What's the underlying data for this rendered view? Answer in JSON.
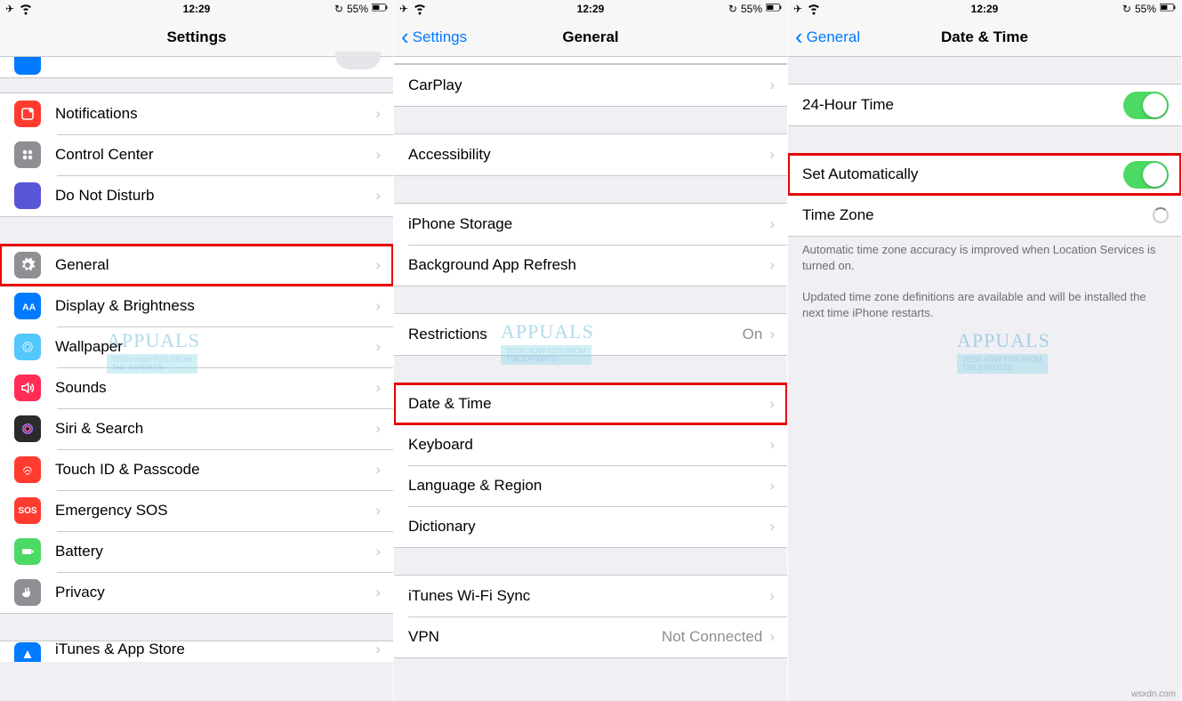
{
  "status": {
    "time": "12:29",
    "battery": "55%"
  },
  "watermark": {
    "name": "APPUALS",
    "tagline1": "TECH HOW-TO'S FROM",
    "tagline2": "THE EXPERTS!"
  },
  "attribution": "wsxdn.com",
  "screen1": {
    "title": "Settings",
    "items": {
      "notifications": "Notifications",
      "control_center": "Control Center",
      "dnd": "Do Not Disturb",
      "general": "General",
      "display": "Display & Brightness",
      "wallpaper": "Wallpaper",
      "sounds": "Sounds",
      "siri": "Siri & Search",
      "touch_id": "Touch ID & Passcode",
      "sos": "Emergency SOS",
      "battery": "Battery",
      "privacy": "Privacy",
      "itunes": "iTunes & App Store"
    }
  },
  "screen2": {
    "back": "Settings",
    "title": "General",
    "items": {
      "carplay": "CarPlay",
      "accessibility": "Accessibility",
      "iphone_storage": "iPhone Storage",
      "bg_refresh": "Background App Refresh",
      "restrictions": "Restrictions",
      "restrictions_value": "On",
      "date_time": "Date & Time",
      "keyboard": "Keyboard",
      "language": "Language & Region",
      "dictionary": "Dictionary",
      "itunes_wifi": "iTunes Wi-Fi Sync",
      "vpn": "VPN",
      "vpn_value": "Not Connected"
    }
  },
  "screen3": {
    "back": "General",
    "title": "Date & Time",
    "items": {
      "hour24": "24-Hour Time",
      "set_auto": "Set Automatically",
      "time_zone": "Time Zone"
    },
    "footer1": "Automatic time zone accuracy is improved when Location Services is turned on.",
    "footer2": "Updated time zone definitions are available and will be installed the next time iPhone restarts."
  },
  "icon_colors": {
    "blue": "#007aff",
    "red": "#ff3b30",
    "grey": "#8e8e93",
    "purple": "#5856d6",
    "green": "#4cd964",
    "darkblue": "#1f6fde",
    "black": "#2b2b2b",
    "pink": "#ff2d55"
  }
}
